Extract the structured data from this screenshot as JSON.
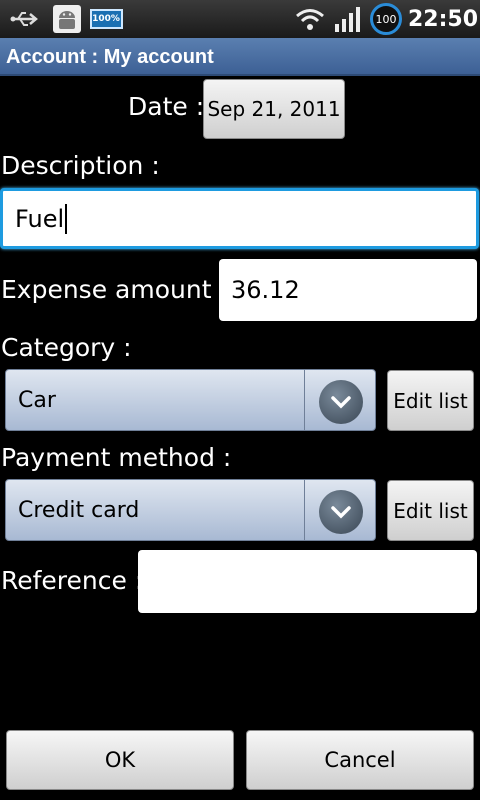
{
  "status_bar": {
    "battery_small_label": "100%",
    "circle_label": "100",
    "time": "22:50",
    "icons": [
      "usb-icon",
      "android-debug-icon",
      "battery-icon",
      "wifi-icon",
      "signal-icon",
      "battery-circle-icon"
    ]
  },
  "title_bar": {
    "title": "Account : My account"
  },
  "date": {
    "label": "Date :",
    "value": "Sep 21, 2011"
  },
  "description": {
    "label": "Description :",
    "value": "Fuel"
  },
  "expense": {
    "label": "Expense amount :",
    "value": "36.12"
  },
  "category": {
    "label": "Category :",
    "selected": "Car",
    "edit_label": "Edit list"
  },
  "payment": {
    "label": "Payment method :",
    "selected": "Credit card",
    "edit_label": "Edit list"
  },
  "reference": {
    "label": "Reference :",
    "value": ""
  },
  "buttons": {
    "ok": "OK",
    "cancel": "Cancel"
  },
  "colors": {
    "title_bar": "#3d6095",
    "focus": "#1e9be0",
    "background": "#000000"
  }
}
